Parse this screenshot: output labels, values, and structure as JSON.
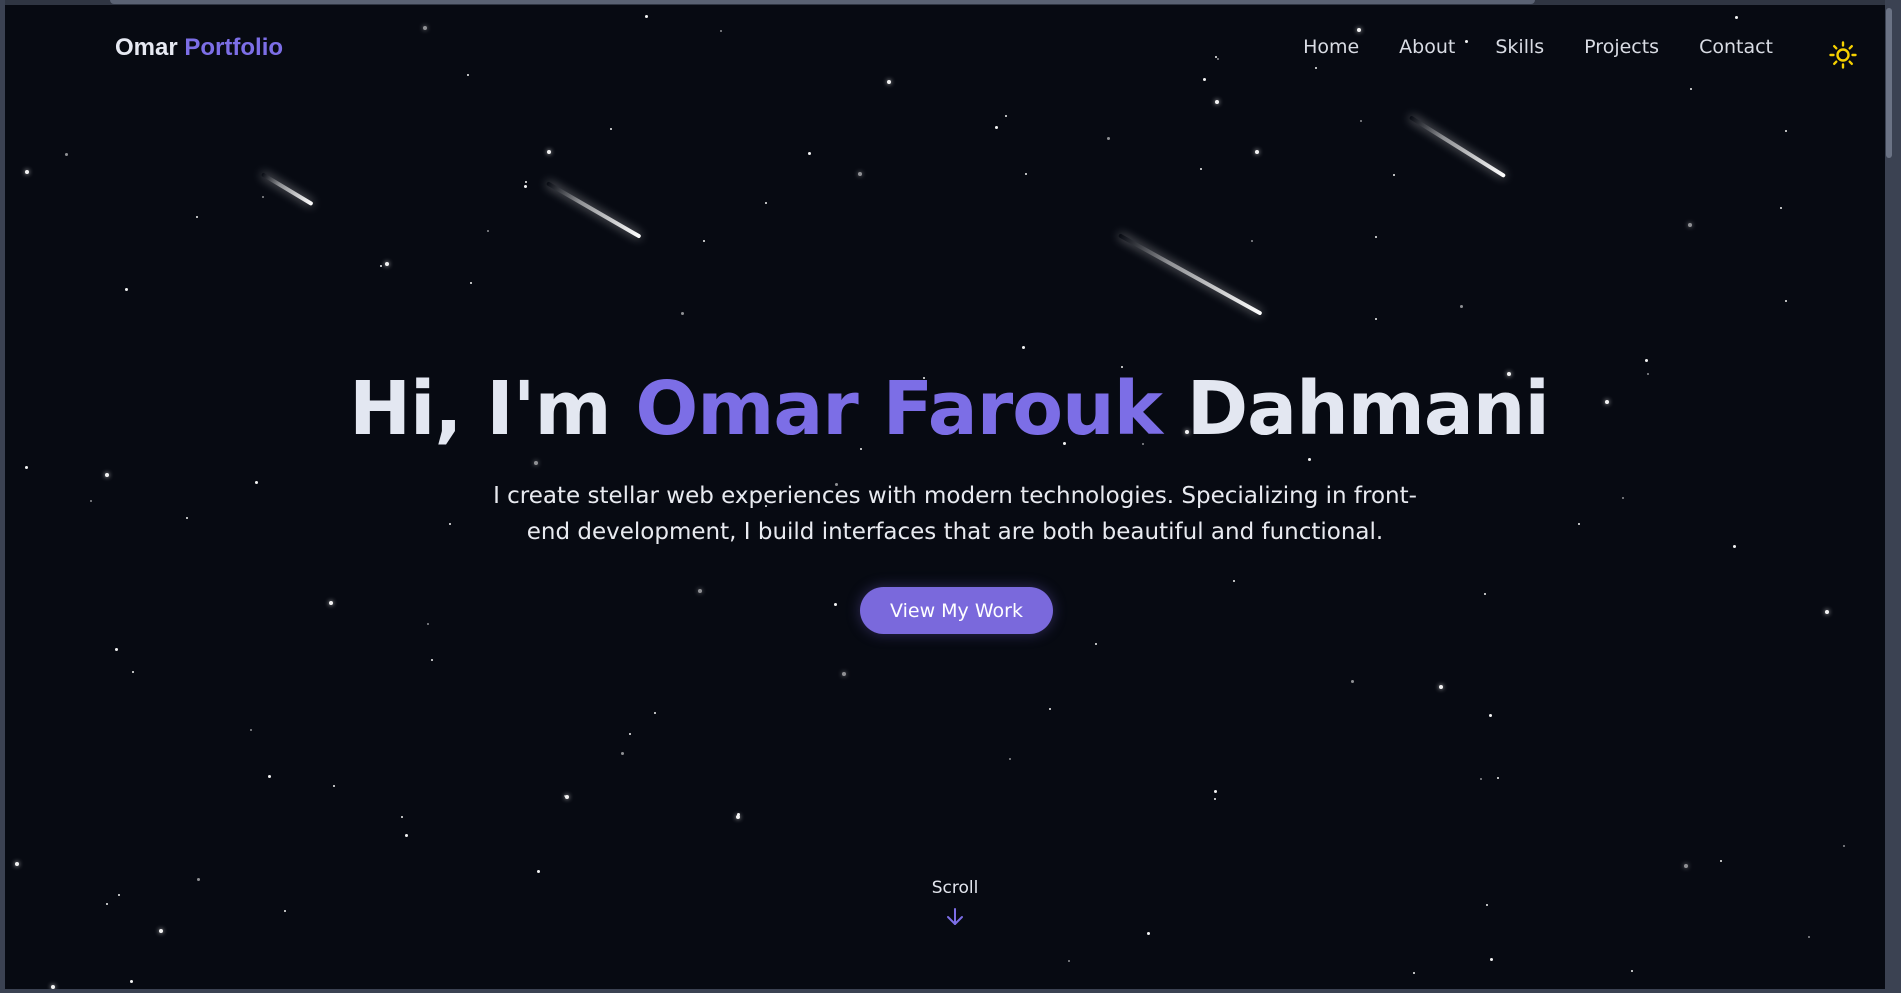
{
  "brand": {
    "first": "Omar",
    "second": "Portfolio"
  },
  "nav": {
    "items": [
      {
        "label": "Home"
      },
      {
        "label": "About"
      },
      {
        "label": "Skills"
      },
      {
        "label": "Projects"
      },
      {
        "label": "Contact"
      }
    ],
    "theme_toggle_icon": "sun-icon"
  },
  "hero": {
    "greeting": "Hi, I'm",
    "name_accent": "Omar Farouk",
    "name_rest": "Dahmani",
    "subtitle": "I create stellar web experiences with modern technologies. Specializing in front-end development, I build interfaces that are both beautiful and functional.",
    "cta_label": "View My Work"
  },
  "scroll_cue": {
    "label": "Scroll",
    "icon": "arrow-down-icon"
  },
  "colors": {
    "background": "#070a12",
    "accent": "#7c6ee6",
    "button": "#7a69dc",
    "sun": "#f5d000",
    "text": "#e3e7f1"
  }
}
